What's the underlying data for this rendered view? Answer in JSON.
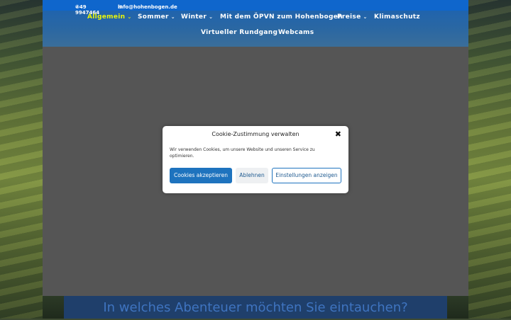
{
  "topbar": {
    "phone": "+49 9947464",
    "email": "info@hohenbogen.de",
    "phone_icon": "phone-icon",
    "mail_icon": "mail-icon"
  },
  "nav": {
    "items": [
      {
        "label": "Allgemein",
        "has_dropdown": true,
        "active": true
      },
      {
        "label": "Sommer",
        "has_dropdown": true
      },
      {
        "label": "Winter",
        "has_dropdown": true
      },
      {
        "label": "Mit dem ÖPVN zum Hohenbogen",
        "has_dropdown": false
      },
      {
        "label": "Preise",
        "has_dropdown": true
      },
      {
        "label": "Klimaschutz",
        "has_dropdown": false
      },
      {
        "label": "Virtueller Rundgang",
        "has_dropdown": false
      },
      {
        "label": "Webcams",
        "has_dropdown": false
      }
    ],
    "active_color": "#e9f50a"
  },
  "tagline": "In welches Abenteuer möchten Sie eintauchen?",
  "cookie_dialog": {
    "title": "Cookie-Zustimmung verwalten",
    "text": "Wir verwenden Cookies, um unsere Website und unseren Service zu optimieren.",
    "accept": "Cookies akzeptieren",
    "deny": "Ablehnen",
    "settings": "Einstellungen anzeigen",
    "close_icon": "close-icon"
  },
  "colors": {
    "header_blue": "#1a62b3",
    "accept_button": "#1e73be"
  }
}
